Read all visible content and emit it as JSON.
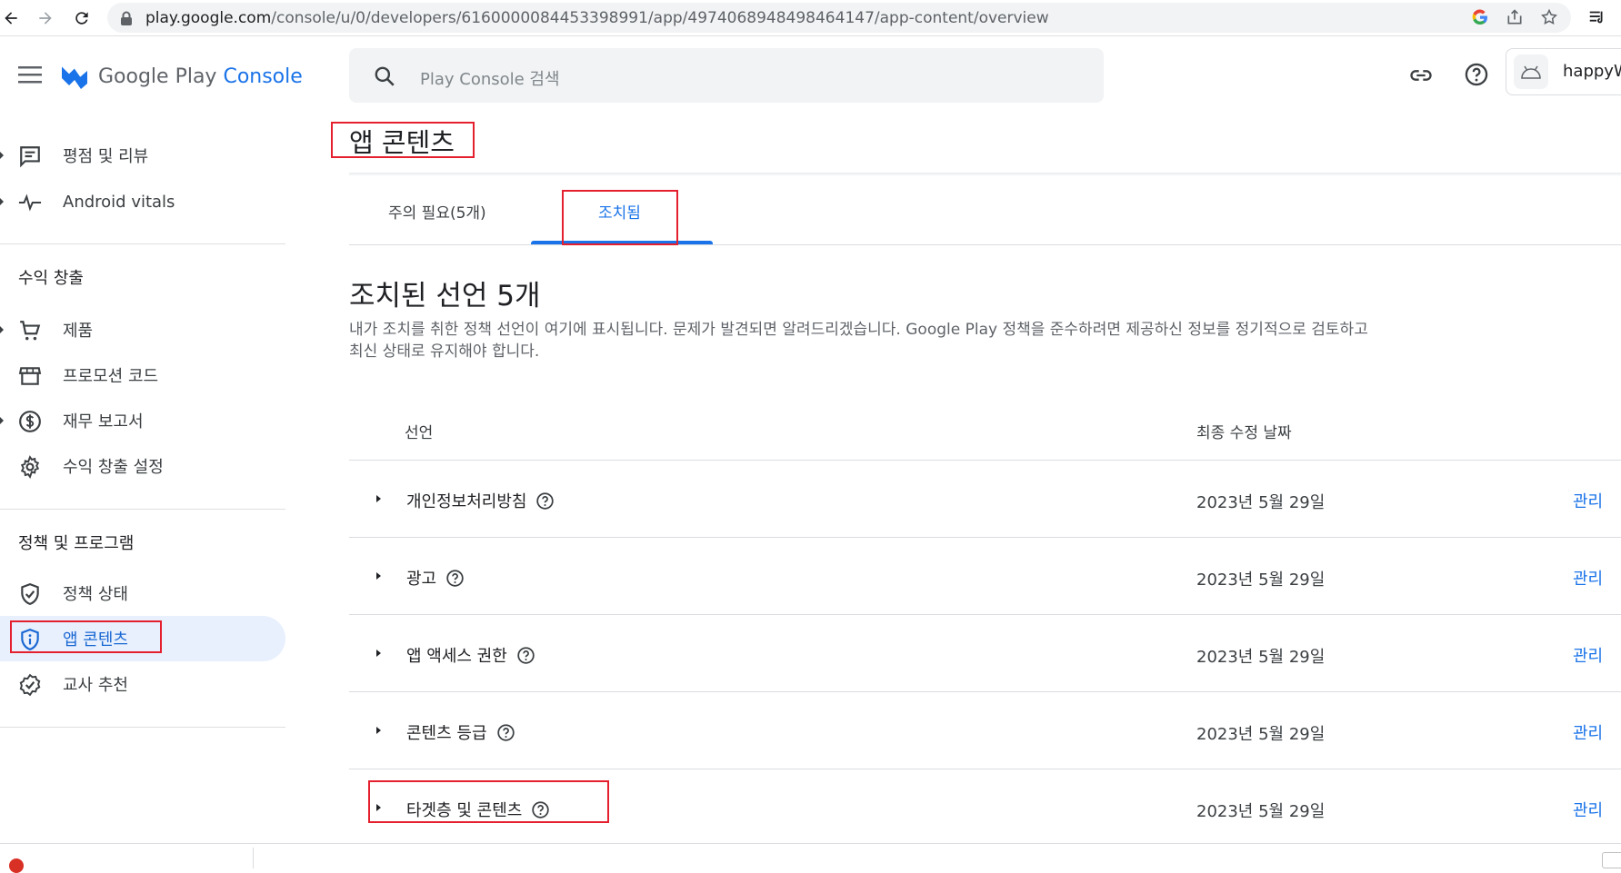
{
  "browser": {
    "url_host": "play.google.com",
    "url_path": "/console/u/0/developers/6160000084453398991/app/4974068948498464147/app-content/overview"
  },
  "header": {
    "logo_text_main": "Google Play",
    "logo_text_accent": "Console",
    "search_placeholder": "Play Console 검색",
    "account_name": "happyW"
  },
  "sidebar": {
    "items_top": [
      {
        "label": "평점 및 리뷰",
        "icon": "reviews-icon"
      },
      {
        "label": "Android vitals",
        "icon": "vitals-icon"
      }
    ],
    "monetization": {
      "title": "수익 창출",
      "items": [
        {
          "label": "제품",
          "icon": "cart-icon"
        },
        {
          "label": "프로모션 코드",
          "icon": "store-icon"
        },
        {
          "label": "재무 보고서",
          "icon": "dollar-icon"
        },
        {
          "label": "수익 창출 설정",
          "icon": "gear-icon"
        }
      ]
    },
    "policy": {
      "title": "정책 및 프로그램",
      "items": [
        {
          "label": "정책 상태",
          "icon": "shield-check-icon"
        },
        {
          "label": "앱 콘텐츠",
          "icon": "shield-info-icon"
        },
        {
          "label": "교사 추천",
          "icon": "badge-icon"
        }
      ]
    }
  },
  "main": {
    "title": "앱 콘텐츠",
    "tabs": [
      {
        "label": "주의 필요(5개)"
      },
      {
        "label": "조치됨"
      }
    ],
    "section_heading": "조치된 선언 5개",
    "description": "내가 조치를 취한 정책 선언이 여기에 표시됩니다. 문제가 발견되면 알려드리겠습니다. Google Play 정책을 준수하려면 제공하신 정보를 정기적으로 검토하고 최신 상태로 유지해야 합니다.",
    "table": {
      "col_declaration": "선언",
      "col_last_updated": "최종 수정 날짜",
      "rows": [
        {
          "name": "개인정보처리방침",
          "date": "2023년 5월 29일",
          "action": "관리"
        },
        {
          "name": "광고",
          "date": "2023년 5월 29일",
          "action": "관리"
        },
        {
          "name": "앱 액세스 권한",
          "date": "2023년 5월 29일",
          "action": "관리"
        },
        {
          "name": "콘텐츠 등급",
          "date": "2023년 5월 29일",
          "action": "관리"
        },
        {
          "name": "타겟층 및 콘텐츠",
          "date": "2023년 5월 29일",
          "action": "관리"
        }
      ]
    }
  },
  "colors": {
    "accent": "#1a73e8",
    "active_bg": "#e8f0fe",
    "highlight": "#e5202e"
  }
}
